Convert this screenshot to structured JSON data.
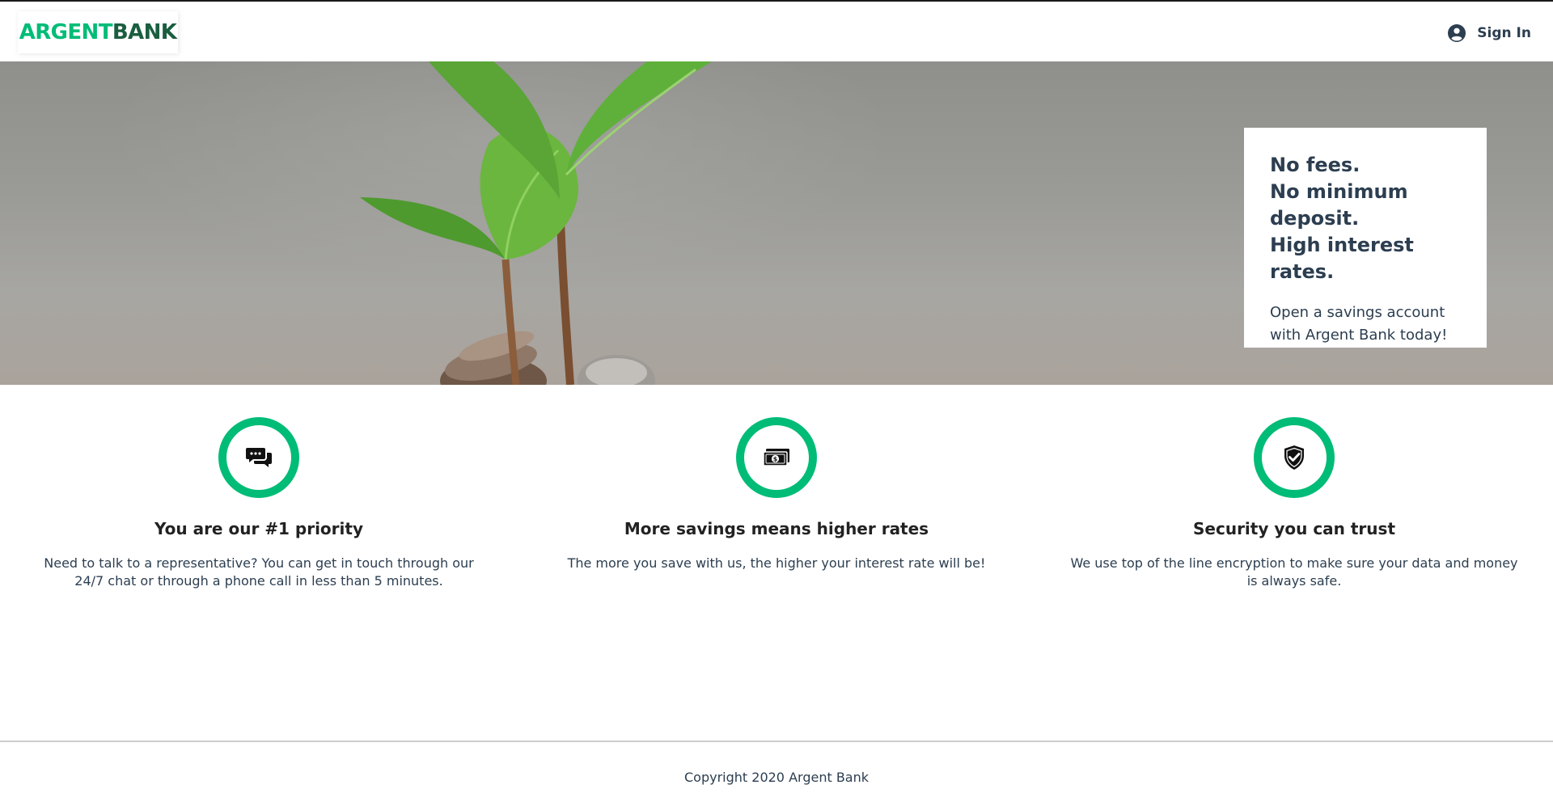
{
  "header": {
    "logo_part1": "ARGENT",
    "logo_part2": "BANK",
    "signin_label": "Sign In",
    "signin_icon": "user-circle-icon"
  },
  "hero": {
    "subtitles": [
      "No fees.",
      "No minimum deposit.",
      "High interest rates."
    ],
    "text": "Open a savings account with Argent Bank today!"
  },
  "features": [
    {
      "icon": "chat-icon",
      "title": "You are our #1 priority",
      "description": "Need to talk to a representative? You can get in touch through our 24/7 chat or through a phone call in less than 5 minutes."
    },
    {
      "icon": "money-icon",
      "title": "More savings means higher rates",
      "description": "The more you save with us, the higher your interest rate will be!"
    },
    {
      "icon": "security-icon",
      "title": "Security you can trust",
      "description": "We use top of the line encryption to make sure your data and money is always safe."
    }
  ],
  "footer": {
    "copyright": "Copyright 2020 Argent Bank"
  },
  "colors": {
    "brand_green": "#00bc77",
    "brand_dark_green": "#1a5e3f",
    "text_dark": "#2c3e50"
  }
}
